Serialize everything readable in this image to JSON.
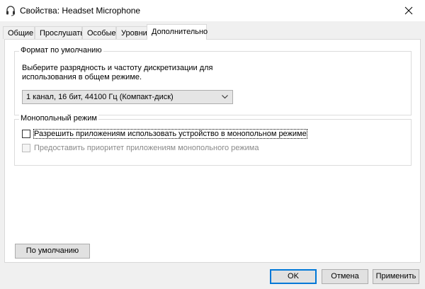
{
  "window": {
    "title": "Свойства: Headset Microphone",
    "icon": "headset-icon",
    "close_icon": "close-icon"
  },
  "tabs": [
    {
      "label": "Общие",
      "active": false
    },
    {
      "label": "Прослушать",
      "active": false
    },
    {
      "label": "Особые",
      "active": false
    },
    {
      "label": "Уровни",
      "active": false
    },
    {
      "label": "Дополнительно",
      "active": true
    }
  ],
  "default_format": {
    "title": "Формат по умолчанию",
    "description": "Выберите разрядность и частоту дискретизации для использования в общем режиме.",
    "selected_value": "1 канал, 16 бит, 44100 Гц (Компакт-диск)"
  },
  "exclusive_mode": {
    "title": "Монопольный режим",
    "allow_exclusive": {
      "label": "Разрешить приложениям использовать устройство в монопольном режиме",
      "checked": false
    },
    "give_priority": {
      "label": "Предоставить приоритет приложениям монопольного режима",
      "checked": false,
      "disabled": true
    }
  },
  "buttons": {
    "restore_defaults": "По умолчанию",
    "ok": "OK",
    "cancel": "Отмена",
    "apply": "Применить"
  },
  "colors": {
    "accent": "#0078d7",
    "window_bg": "#f0f0f0",
    "panel_bg": "#ffffff"
  }
}
